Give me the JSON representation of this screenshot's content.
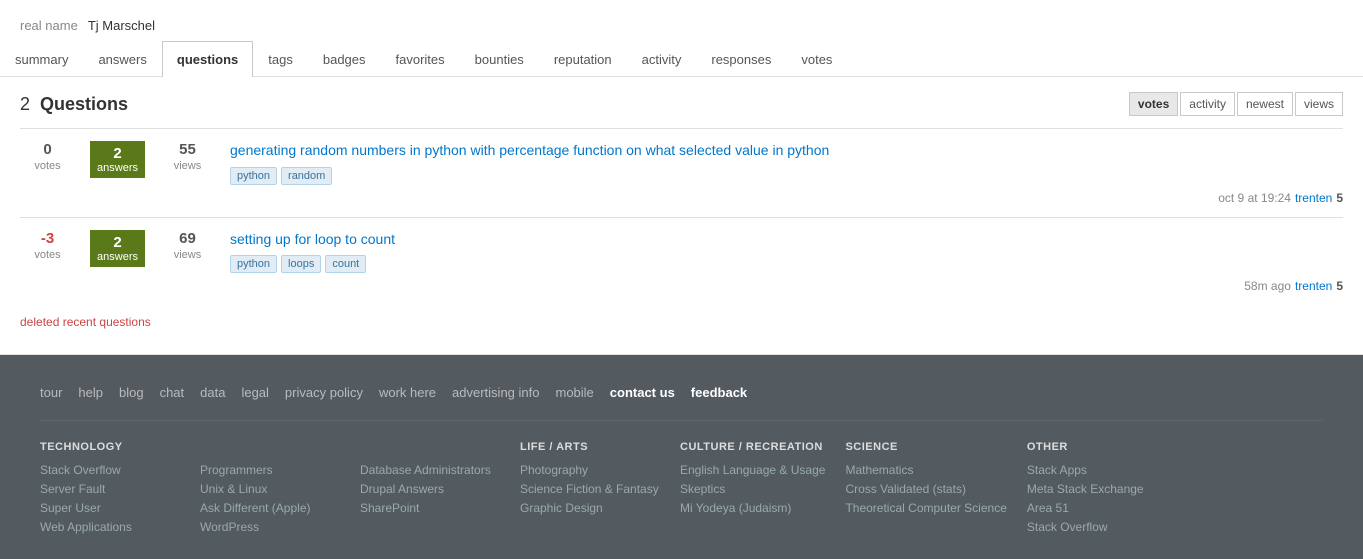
{
  "profile": {
    "real_name_label": "real name",
    "real_name_value": "Tj Marschel"
  },
  "tabs": [
    {
      "id": "summary",
      "label": "summary",
      "active": false
    },
    {
      "id": "answers",
      "label": "answers",
      "active": false
    },
    {
      "id": "questions",
      "label": "questions",
      "active": true
    },
    {
      "id": "tags",
      "label": "tags",
      "active": false
    },
    {
      "id": "badges",
      "label": "badges",
      "active": false
    },
    {
      "id": "favorites",
      "label": "favorites",
      "active": false
    },
    {
      "id": "bounties",
      "label": "bounties",
      "active": false
    },
    {
      "id": "reputation",
      "label": "reputation",
      "active": false
    },
    {
      "id": "activity",
      "label": "activity",
      "active": false
    },
    {
      "id": "responses",
      "label": "responses",
      "active": false
    },
    {
      "id": "votes",
      "label": "votes",
      "active": false
    }
  ],
  "questions_section": {
    "count": "2",
    "title": "Questions",
    "sort_buttons": [
      {
        "id": "votes",
        "label": "votes",
        "active": true
      },
      {
        "id": "activity",
        "label": "activity",
        "active": false
      },
      {
        "id": "newest",
        "label": "newest",
        "active": false
      },
      {
        "id": "views",
        "label": "views",
        "active": false
      }
    ],
    "questions": [
      {
        "votes": "0",
        "votes_label": "votes",
        "answers": "2",
        "answers_label": "answers",
        "views": "55",
        "views_label": "views",
        "title": "generating random numbers in python with percentage function on what selected value in python",
        "tags": [
          "python",
          "random"
        ],
        "meta_date": "oct 9 at 19:24",
        "meta_user": "trenten",
        "meta_rep": "5"
      },
      {
        "votes": "-3",
        "votes_label": "votes",
        "answers": "2",
        "answers_label": "answers",
        "views": "69",
        "views_label": "views",
        "title": "setting up for loop to count",
        "tags": [
          "python",
          "loops",
          "count"
        ],
        "meta_date": "58m ago",
        "meta_user": "trenten",
        "meta_rep": "5"
      }
    ],
    "deleted_link": "deleted recent questions"
  },
  "footer": {
    "nav_links": [
      {
        "label": "tour",
        "bold": false
      },
      {
        "label": "help",
        "bold": false
      },
      {
        "label": "blog",
        "bold": false
      },
      {
        "label": "chat",
        "bold": false
      },
      {
        "label": "data",
        "bold": false
      },
      {
        "label": "legal",
        "bold": false
      },
      {
        "label": "privacy policy",
        "bold": false
      },
      {
        "label": "work here",
        "bold": false
      },
      {
        "label": "advertising info",
        "bold": false
      },
      {
        "label": "mobile",
        "bold": false
      },
      {
        "label": "contact us",
        "bold": true
      },
      {
        "label": "feedback",
        "bold": true
      }
    ],
    "columns": [
      {
        "header": "TECHNOLOGY",
        "links": [
          "Stack Overflow",
          "Server Fault",
          "Super User",
          "Web Applications"
        ]
      },
      {
        "header": "",
        "links": [
          "Programmers",
          "Unix & Linux",
          "Ask Different (Apple)",
          "WordPress"
        ]
      },
      {
        "header": "",
        "links": [
          "Database Administrators",
          "Drupal Answers",
          "SharePoint"
        ]
      },
      {
        "header": "LIFE / ARTS",
        "links": [
          "Photography",
          "Science Fiction & Fantasy",
          "Graphic Design"
        ]
      },
      {
        "header": "CULTURE / RECREATION",
        "links": [
          "English Language & Usage",
          "Skeptics",
          "Mi Yodeya (Judaism)"
        ]
      },
      {
        "header": "SCIENCE",
        "links": [
          "Mathematics",
          "Cross Validated (stats)",
          "Theoretical Computer Science"
        ]
      },
      {
        "header": "OTHER",
        "links": [
          "Stack Apps",
          "Meta Stack Exchange",
          "Area 51",
          "Stack Overflow"
        ]
      }
    ]
  }
}
